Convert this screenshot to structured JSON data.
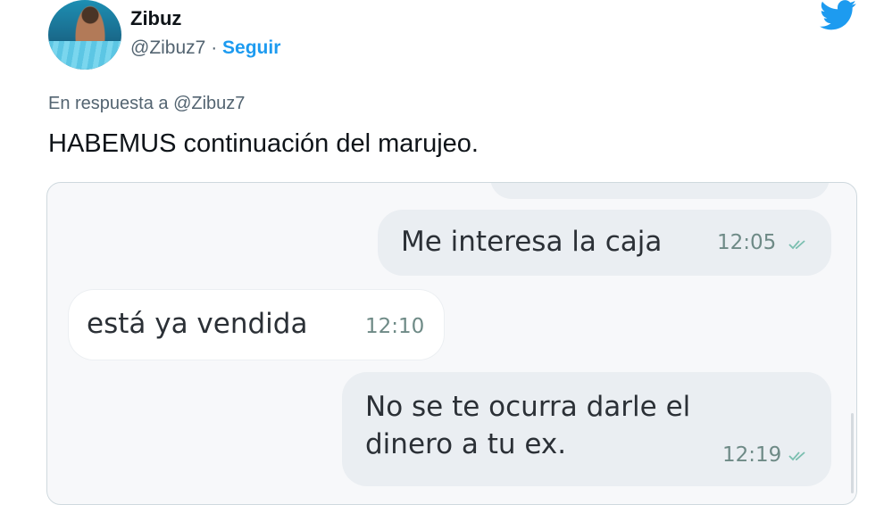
{
  "author": {
    "name": "Zibuz",
    "handle": "@Zibuz7",
    "separator": " · ",
    "follow_label": "Seguir",
    "avatar_icon": "avatar-photo"
  },
  "brand": {
    "icon": "twitter-bird-icon",
    "color": "#1d9bf0"
  },
  "tweet": {
    "reply_to": "En respuesta a @Zibuz7",
    "text": "HABEMUS continuación del marujeo."
  },
  "chat": {
    "messages": [
      {
        "direction": "outgoing",
        "text": "Me interesa la caja",
        "time": "12:05",
        "status": "delivered"
      },
      {
        "direction": "incoming",
        "text": "está ya vendida",
        "time": "12:10"
      },
      {
        "direction": "outgoing",
        "text_line1": "No se te ocurra darle el",
        "text_line2": "dinero a tu ex.",
        "time": "12:19",
        "status": "delivered"
      }
    ]
  }
}
